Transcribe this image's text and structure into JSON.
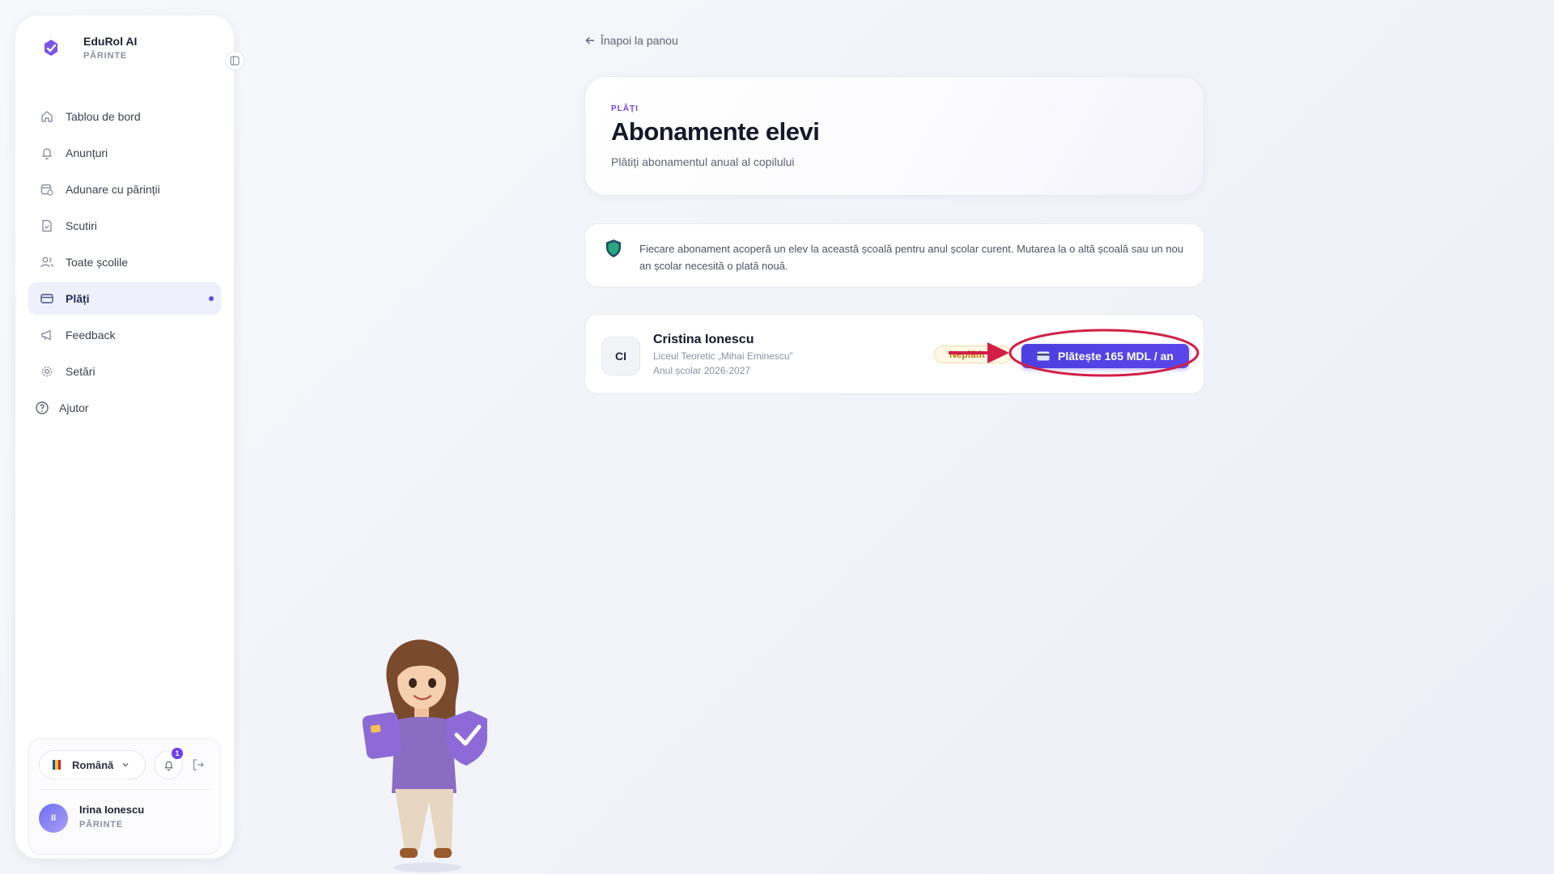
{
  "brand": {
    "name": "EduRol AI",
    "role": "PĂRINTE"
  },
  "sidebar": {
    "items": [
      {
        "label": "Tablou de bord",
        "icon": "home-icon"
      },
      {
        "label": "Anunțuri",
        "icon": "bell-icon"
      },
      {
        "label": "Adunare cu părinții",
        "icon": "calendar-icon"
      },
      {
        "label": "Scutiri",
        "icon": "document-check-icon"
      },
      {
        "label": "Toate școlile",
        "icon": "users-icon"
      },
      {
        "label": "Plăți",
        "icon": "credit-card-icon",
        "active": true
      },
      {
        "label": "Feedback",
        "icon": "megaphone-icon"
      },
      {
        "label": "Setări",
        "icon": "gear-icon"
      }
    ],
    "help_label": "Ajutor"
  },
  "language": {
    "selected": "Română"
  },
  "notifications": {
    "count": "1"
  },
  "user": {
    "initials": "II",
    "name": "Irina Ionescu",
    "role": "PĂRINTE"
  },
  "back_link": "Înapoi la panou",
  "header": {
    "eyebrow": "PLĂȚI",
    "title": "Abonamente elevi",
    "subtitle": "Plătiți abonamentul anual al copilului"
  },
  "info": {
    "text": "Fiecare abonament acoperă un elev la această școală pentru anul școlar curent. Mutarea la o altă școală sau un nou an școlar necesită o plată nouă."
  },
  "student": {
    "initials": "CI",
    "name": "Cristina Ionescu",
    "school": "Liceul Teoretic „Mihai Eminescu”",
    "year": "Anul școlar 2026-2027",
    "status": "Neplătit",
    "pay_label": "Plătește 165 MDL / an"
  },
  "colors": {
    "accent": "#5a46ea",
    "annotation": "#d21f45",
    "eyebrow": "#7b3fe4"
  }
}
